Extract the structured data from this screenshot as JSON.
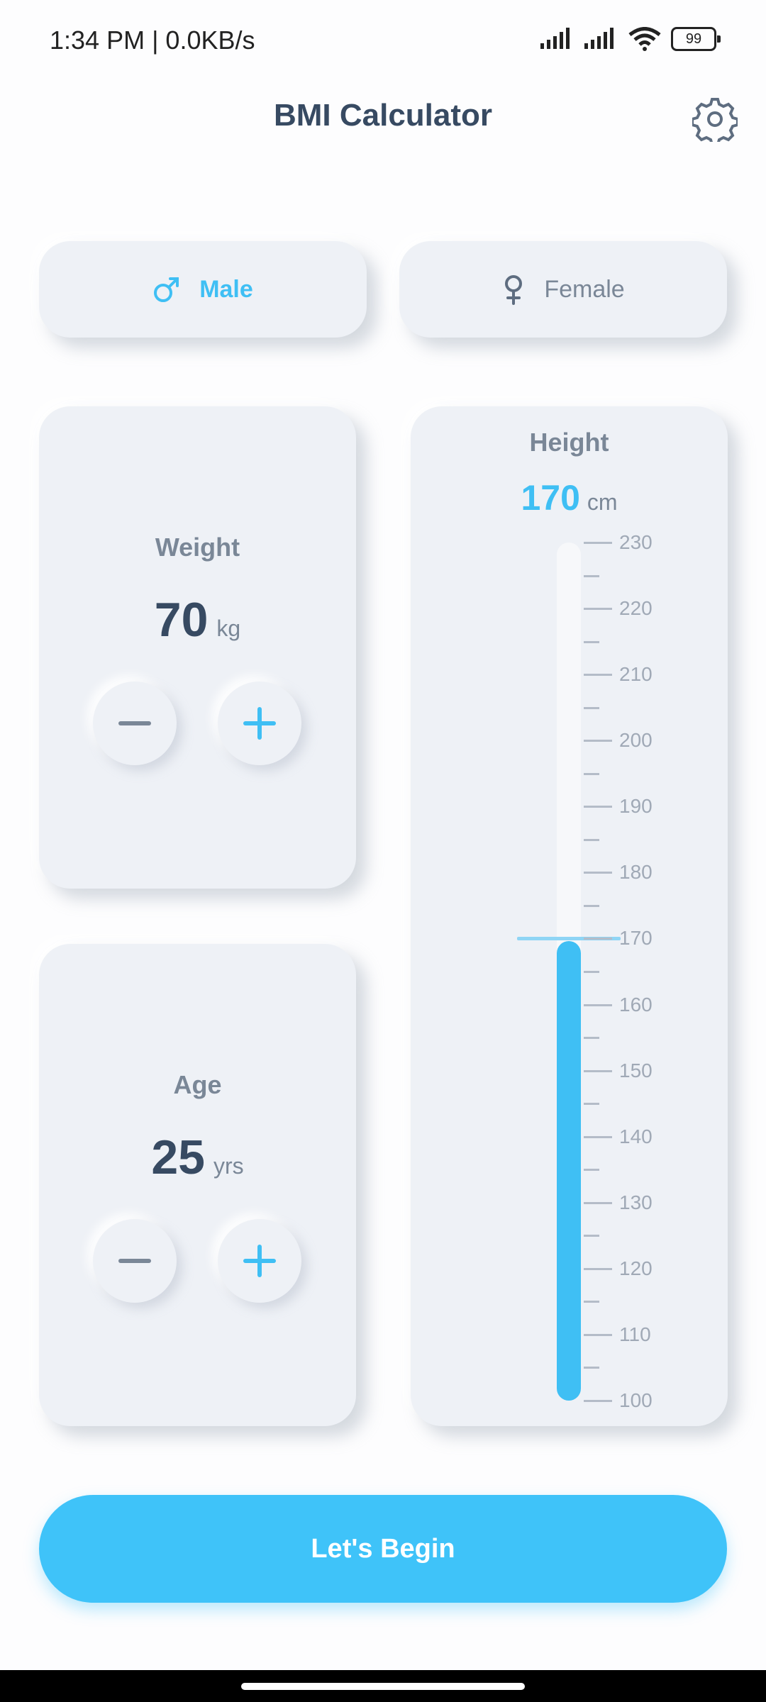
{
  "status_bar": {
    "time": "1:34 PM | 0.0KB/s",
    "battery": "99"
  },
  "header": {
    "title": "BMI Calculator"
  },
  "gender": {
    "selected": "Male",
    "options": [
      {
        "label": "Male",
        "icon": "male-symbol-icon"
      },
      {
        "label": "Female",
        "icon": "female-symbol-icon"
      }
    ]
  },
  "weight": {
    "label": "Weight",
    "value": "70",
    "unit": "kg"
  },
  "age": {
    "label": "Age",
    "value": "25",
    "unit": "yrs"
  },
  "height": {
    "label": "Height",
    "value": "170",
    "unit": "cm",
    "min": 100,
    "max": 230,
    "current": 170,
    "scale_labels": [
      "230",
      "220",
      "210",
      "200",
      "190",
      "180",
      "170",
      "160",
      "150",
      "140",
      "130",
      "120",
      "110",
      "100"
    ]
  },
  "actions": {
    "begin_label": "Let's Begin"
  },
  "colors": {
    "accent": "#3fbff4",
    "text_dark": "#374a62",
    "text_muted": "#7a8797",
    "card_bg": "#eef1f6"
  }
}
